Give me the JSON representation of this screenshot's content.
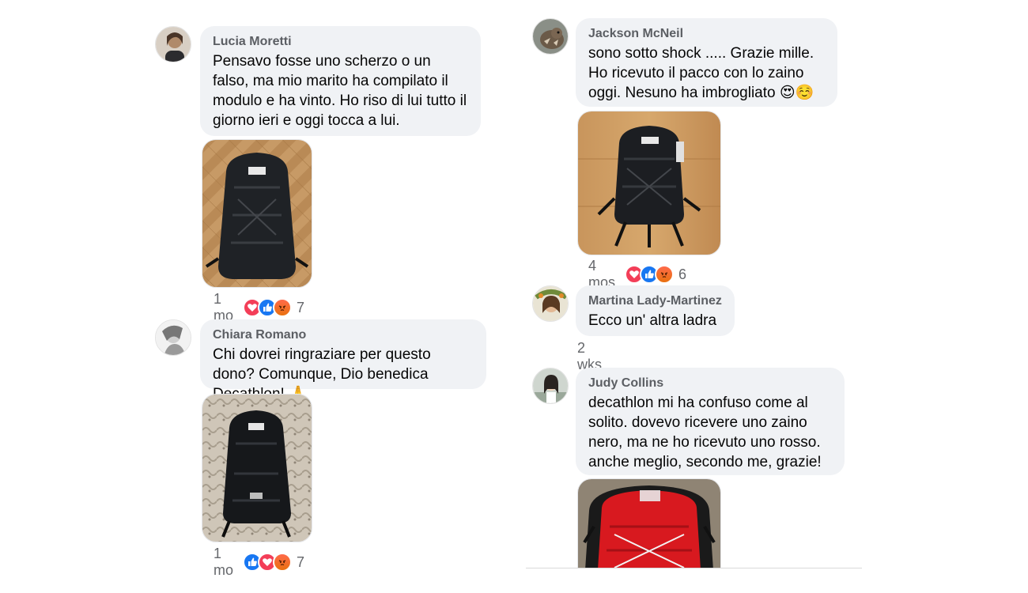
{
  "comments_left": [
    {
      "author": "Lucia Moretti",
      "text": "Pensavo fosse uno scherzo o un falso, ma mio marito ha compilato il modulo e ha vinto. Ho riso di lui tutto il giorno ieri e oggi tocca a lui.",
      "time": "1 mo",
      "reactions": [
        "love-icon",
        "like-icon",
        "angry-icon"
      ],
      "reaction_count": "7"
    },
    {
      "author": "Chiara Romano",
      "text": "Chi dovrei ringraziare per questo dono? Comunque, Dio benedica Decathlon! 🙏",
      "time": "1 mo",
      "reactions": [
        "like-icon",
        "love-icon",
        "angry-icon"
      ],
      "reaction_count": "7"
    }
  ],
  "comments_right": [
    {
      "author": "Jackson McNeil",
      "text": "sono sotto shock ..... Grazie mille. Ho ricevuto il pacco con lo zaino oggi. Nesuno ha imbrogliato 😍☺️",
      "time": "4 mos",
      "reactions": [
        "love-icon",
        "like-icon",
        "angry-icon"
      ],
      "reaction_count": "6"
    },
    {
      "author": "Martina Lady-Martinez",
      "text": "Ecco un' altra ladra",
      "time": "2 wks"
    },
    {
      "author": "Judy Collins",
      "text": "decathlon mi ha confuso come al solito. dovevo ricevere uno zaino nero, ma ne ho ricevuto uno rosso. anche meglio, secondo me, grazie!"
    }
  ],
  "colors": {
    "bubble": "#f0f2f5",
    "like": "#1877f2",
    "love": "#f33e58",
    "angry": "#e9710f",
    "backpack_black": "#1f2226",
    "backpack_red": "#d8191f"
  }
}
